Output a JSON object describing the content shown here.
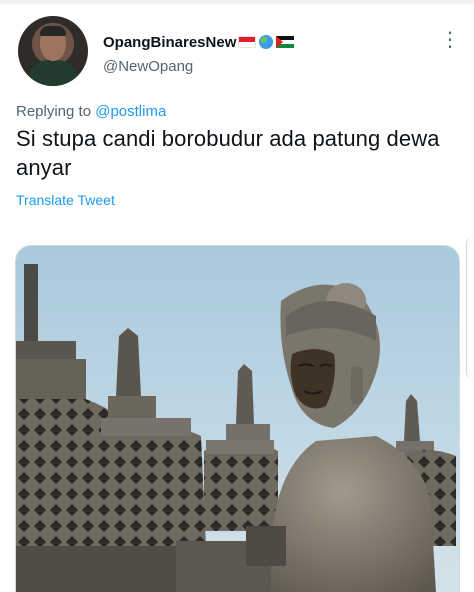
{
  "tweet": {
    "display_name": "OpangBinaresNew",
    "handle": "@NewOpang",
    "reply_prefix": "Replying to",
    "reply_to": "@postlima",
    "text": "Si stupa candi borobudur ada patung dewa anyar",
    "translate_label": "Translate Tweet",
    "more_icon": "⋮"
  },
  "icons": {
    "flag_indonesia": "indonesia-flag-icon",
    "globe": "globe-icon",
    "flag_palestine": "palestine-flag-icon",
    "more": "more-options-icon"
  },
  "colors": {
    "link": "#1d9bf0",
    "secondary_text": "#536471",
    "primary_text": "#0f1419",
    "sky": "#b7d4e6",
    "stone": "#6d6a62"
  }
}
